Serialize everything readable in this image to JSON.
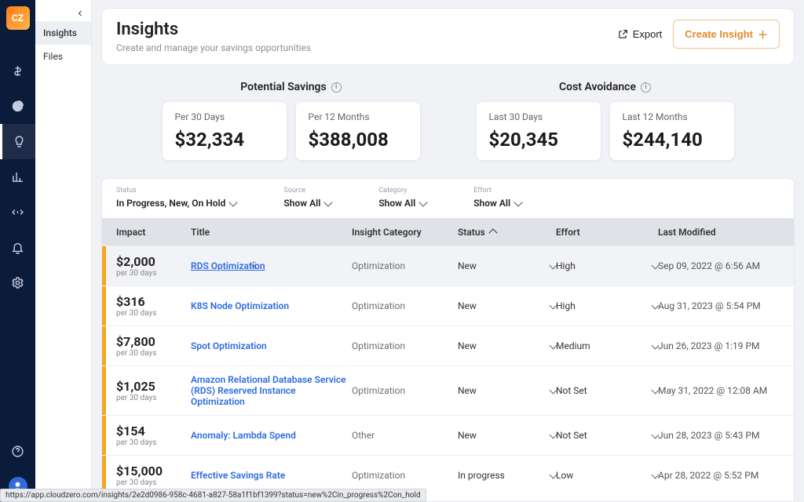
{
  "brand": "CZ",
  "sidebar": {
    "items": [
      {
        "label": "Insights",
        "active": true
      },
      {
        "label": "Files",
        "active": false
      }
    ]
  },
  "header": {
    "title": "Insights",
    "subtitle": "Create and manage your savings opportunities",
    "export_label": "Export",
    "create_label": "Create Insight"
  },
  "summary": {
    "potential_label": "Potential Savings",
    "avoidance_label": "Cost Avoidance",
    "cards": [
      {
        "label": "Per 30 Days",
        "value": "$32,334"
      },
      {
        "label": "Per 12 Months",
        "value": "$388,008"
      },
      {
        "label": "Last 30 Days",
        "value": "$20,345"
      },
      {
        "label": "Last 12 Months",
        "value": "$244,140"
      }
    ]
  },
  "filters": {
    "status": {
      "label": "Status",
      "value": "In Progress, New, On Hold"
    },
    "source": {
      "label": "Source",
      "value": "Show All"
    },
    "category": {
      "label": "Category",
      "value": "Show All"
    },
    "effort": {
      "label": "Effort",
      "value": "Show All"
    }
  },
  "table": {
    "headers": {
      "impact": "Impact",
      "title": "Title",
      "category": "Insight Category",
      "status": "Status",
      "effort": "Effort",
      "modified": "Last Modified"
    },
    "impact_per_label": "per 30 days",
    "rows": [
      {
        "impact": "$2,000",
        "title": "RDS Optimization",
        "category": "Optimization",
        "status": "New",
        "effort": "High",
        "modified": "Sep 09, 2022 @ 6:56 AM",
        "selected": true
      },
      {
        "impact": "$316",
        "title": "K8S Node Optimization",
        "category": "Optimization",
        "status": "New",
        "effort": "High",
        "modified": "Aug 31, 2023 @ 5:54 PM"
      },
      {
        "impact": "$7,800",
        "title": "Spot Optimization",
        "category": "Optimization",
        "status": "New",
        "effort": "Medium",
        "modified": "Jun 26, 2023 @ 1:19 PM"
      },
      {
        "impact": "$1,025",
        "title": "Amazon Relational Database Service (RDS) Reserved Instance Optimization",
        "category": "Optimization",
        "status": "New",
        "effort": "Not Set",
        "modified": "May 31, 2022 @ 12:08 AM"
      },
      {
        "impact": "$154",
        "title": "Anomaly: Lambda Spend",
        "category": "Other",
        "status": "New",
        "effort": "Not Set",
        "modified": "Jun 28, 2023 @ 5:43 PM"
      },
      {
        "impact": "$15,000",
        "title": "Effective Savings Rate",
        "category": "Optimization",
        "status": "In progress",
        "effort": "Low",
        "modified": "Apr 28, 2022 @ 5:52 PM"
      }
    ]
  },
  "statusbar_url": "https://app.cloudzero.com/insights/2e2d0986-958c-4681-a827-58a1f1bf1399?status=new%2Cin_progress%2Con_hold"
}
